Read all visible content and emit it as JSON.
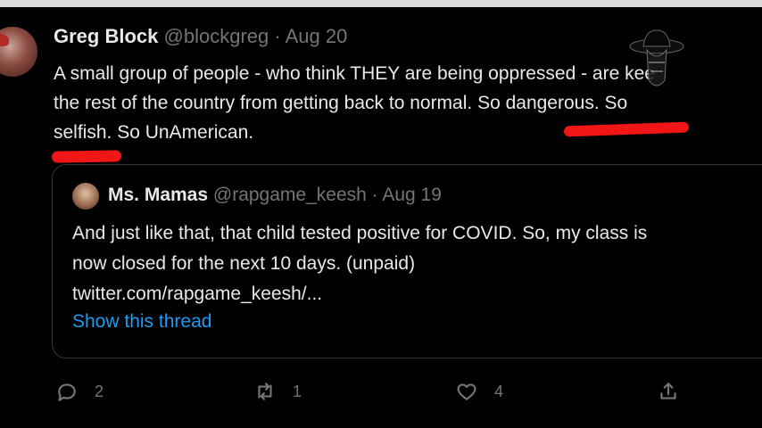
{
  "tweet": {
    "author_name": "Greg Block",
    "author_handle": "@blockgreg",
    "separator": "·",
    "date": "Aug 20",
    "lines": [
      "A small group of people - who think THEY are being oppressed - are kee",
      "the rest of the country from getting back to normal. So dangerous. So",
      "selfish. So UnAmerican."
    ]
  },
  "quote": {
    "author_name": "Ms. Mamas",
    "author_handle": "@rapgame_keesh",
    "separator": "·",
    "date": "Aug 19",
    "lines": [
      "And just like that, that child tested positive for COVID. So, my class is",
      "now closed for the next 10 days. (unpaid)",
      "twitter.com/rapgame_keesh/..."
    ],
    "show_thread_label": "Show this thread"
  },
  "actions": {
    "reply_count": "2",
    "retweet_count": "1",
    "like_count": "4"
  },
  "colors": {
    "accent": "#1d9bf0",
    "annotation": "#f01616"
  }
}
